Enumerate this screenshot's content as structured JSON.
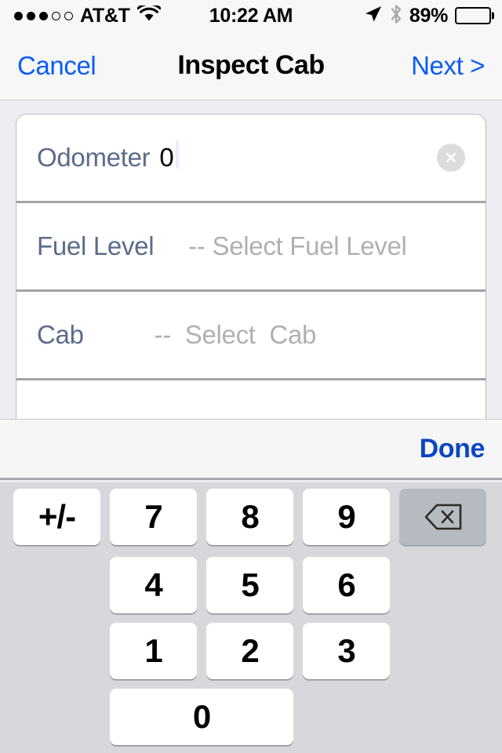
{
  "status_bar": {
    "signal_dots_total": 5,
    "signal_dots_filled": 3,
    "carrier": "AT&T",
    "wifi_icon": "wifi-icon",
    "time": "10:22 AM",
    "location_icon": "location-arrow-icon",
    "bluetooth_icon": "bluetooth-icon",
    "battery_percent": "89%",
    "battery_level": 89
  },
  "nav_bar": {
    "cancel_label": "Cancel",
    "title": "Inspect Cab",
    "next_label": "Next >",
    "tint_color": "#0b5cf5"
  },
  "form": {
    "rows": [
      {
        "label": "Odometer",
        "value": "0",
        "placeholder": "",
        "clear_icon": "clear-circle-icon",
        "focused": true
      },
      {
        "label": "Fuel Level",
        "value": "",
        "placeholder": "-- Select Fuel Level",
        "focused": false
      },
      {
        "label": "Cab",
        "value": "",
        "placeholder": "--  Select  Cab",
        "focused": false
      }
    ],
    "partial_row": {
      "checkbox_icon": "checkbox-checked-icon",
      "checkbox_color": "#0b46c3"
    },
    "label_color": "#5c6b8a",
    "placeholder_color": "#b0b0b0"
  },
  "accessory_bar": {
    "done_label": "Done",
    "tint_color": "#0b46c3"
  },
  "keypad": {
    "background": "#d6d8dc",
    "rows": [
      [
        {
          "label": "+/-",
          "name": "key-plus-minus",
          "type": "key"
        },
        {
          "label": "7",
          "name": "key-7",
          "type": "key"
        },
        {
          "label": "8",
          "name": "key-8",
          "type": "key"
        },
        {
          "label": "9",
          "name": "key-9",
          "type": "key"
        },
        {
          "label": "",
          "name": "key-delete",
          "type": "delete",
          "icon": "backspace-icon"
        }
      ],
      [
        {
          "label": "",
          "name": "key-spacer-left",
          "type": "spacer"
        },
        {
          "label": "4",
          "name": "key-4",
          "type": "key"
        },
        {
          "label": "5",
          "name": "key-5",
          "type": "key"
        },
        {
          "label": "6",
          "name": "key-6",
          "type": "key"
        },
        {
          "label": "",
          "name": "key-spacer-right",
          "type": "spacer"
        }
      ],
      [
        {
          "label": "",
          "name": "key-spacer-left",
          "type": "spacer"
        },
        {
          "label": "1",
          "name": "key-1",
          "type": "key"
        },
        {
          "label": "2",
          "name": "key-2",
          "type": "key"
        },
        {
          "label": "3",
          "name": "key-3",
          "type": "key"
        },
        {
          "label": "",
          "name": "key-spacer-right",
          "type": "spacer"
        }
      ],
      [
        {
          "label": "",
          "name": "key-spacer-left",
          "type": "spacer"
        },
        {
          "label": "0",
          "name": "key-0",
          "type": "wide"
        },
        {
          "label": "",
          "name": "key-spacer-right",
          "type": "spacer"
        }
      ]
    ]
  }
}
